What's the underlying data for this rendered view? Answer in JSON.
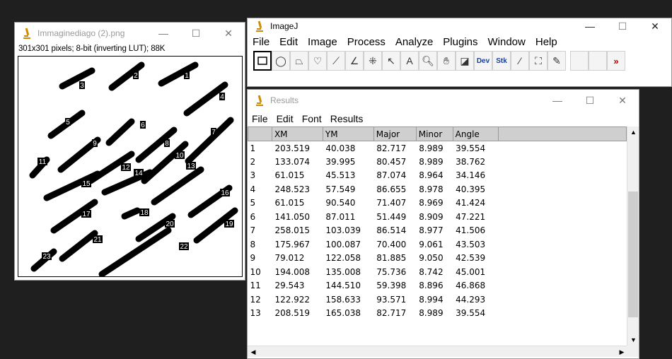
{
  "colors": {
    "accent_red": "#c00000",
    "icon_orange": "#d08a00",
    "header_bg": "#cfcfcf"
  },
  "image_window": {
    "title": "Immaginediago (2).png",
    "info": "301x301 pixels; 8-bit (inverting LUT); 88K",
    "controls": {
      "minimize": "—",
      "maximize": "☐",
      "close": "✕"
    },
    "labels": [
      "1",
      "2",
      "3",
      "4",
      "5",
      "6",
      "7",
      "8",
      "9",
      "10",
      "11",
      "12",
      "14",
      "13",
      "15",
      "16",
      "17",
      "18",
      "19",
      "20",
      "21",
      "22",
      "23"
    ]
  },
  "imagej": {
    "title": "ImageJ",
    "menu": [
      "File",
      "Edit",
      "Image",
      "Process",
      "Analyze",
      "Plugins",
      "Window",
      "Help"
    ],
    "tools": [
      {
        "name": "rectangle-tool",
        "glyph": "",
        "selected": true
      },
      {
        "name": "oval-tool",
        "glyph": "◯"
      },
      {
        "name": "polygon-tool",
        "glyph": "⏢"
      },
      {
        "name": "freehand-tool",
        "glyph": "♡"
      },
      {
        "name": "line-tool",
        "glyph": "⟋"
      },
      {
        "name": "angle-tool",
        "glyph": "∠"
      },
      {
        "name": "point-tool",
        "glyph": "⁜"
      },
      {
        "name": "wand-tool",
        "glyph": "↖"
      },
      {
        "name": "text-tool",
        "glyph": "A"
      },
      {
        "name": "zoom-tool",
        "glyph": "🔍︎"
      },
      {
        "name": "hand-tool",
        "glyph": "✋︎"
      },
      {
        "name": "dropper-tool",
        "glyph": "◪"
      },
      {
        "name": "dev-tool",
        "glyph": "Dev",
        "small": true
      },
      {
        "name": "stk-tool",
        "glyph": "Stk",
        "small": true
      },
      {
        "name": "brush-tool",
        "glyph": "⁄"
      },
      {
        "name": "flood-tool",
        "glyph": "⛶"
      },
      {
        "name": "pencil-tool",
        "glyph": "✎"
      },
      {
        "name": "blank-tool-1",
        "glyph": ""
      },
      {
        "name": "blank-tool-2",
        "glyph": ""
      },
      {
        "name": "more-tools",
        "glyph": "»",
        "arrow": true
      }
    ]
  },
  "results": {
    "title": "Results",
    "menu": [
      "File",
      "Edit",
      "Font",
      "Results"
    ],
    "columns": [
      "",
      "XM",
      "YM",
      "Major",
      "Minor",
      "Angle"
    ],
    "rows": [
      [
        "1",
        "203.519",
        "40.038",
        "82.717",
        "8.989",
        "39.554"
      ],
      [
        "2",
        "133.074",
        "39.995",
        "80.457",
        "8.989",
        "38.762"
      ],
      [
        "3",
        "61.015",
        "45.513",
        "87.074",
        "8.964",
        "34.146"
      ],
      [
        "4",
        "248.523",
        "57.549",
        "86.655",
        "8.978",
        "40.395"
      ],
      [
        "5",
        "61.015",
        "90.540",
        "71.407",
        "8.969",
        "41.424"
      ],
      [
        "6",
        "141.050",
        "87.011",
        "51.449",
        "8.909",
        "47.221"
      ],
      [
        "7",
        "258.015",
        "103.039",
        "86.514",
        "8.977",
        "41.506"
      ],
      [
        "8",
        "175.967",
        "100.087",
        "70.400",
        "9.061",
        "43.503"
      ],
      [
        "9",
        "79.012",
        "122.058",
        "81.885",
        "9.050",
        "42.539"
      ],
      [
        "10",
        "194.008",
        "135.008",
        "75.736",
        "8.742",
        "45.001"
      ],
      [
        "11",
        "29.543",
        "144.510",
        "59.398",
        "8.896",
        "46.868"
      ],
      [
        "12",
        "122.922",
        "158.633",
        "93.571",
        "8.994",
        "44.293"
      ],
      [
        "13",
        "208.519",
        "165.038",
        "82.717",
        "8.989",
        "39.554"
      ]
    ]
  }
}
